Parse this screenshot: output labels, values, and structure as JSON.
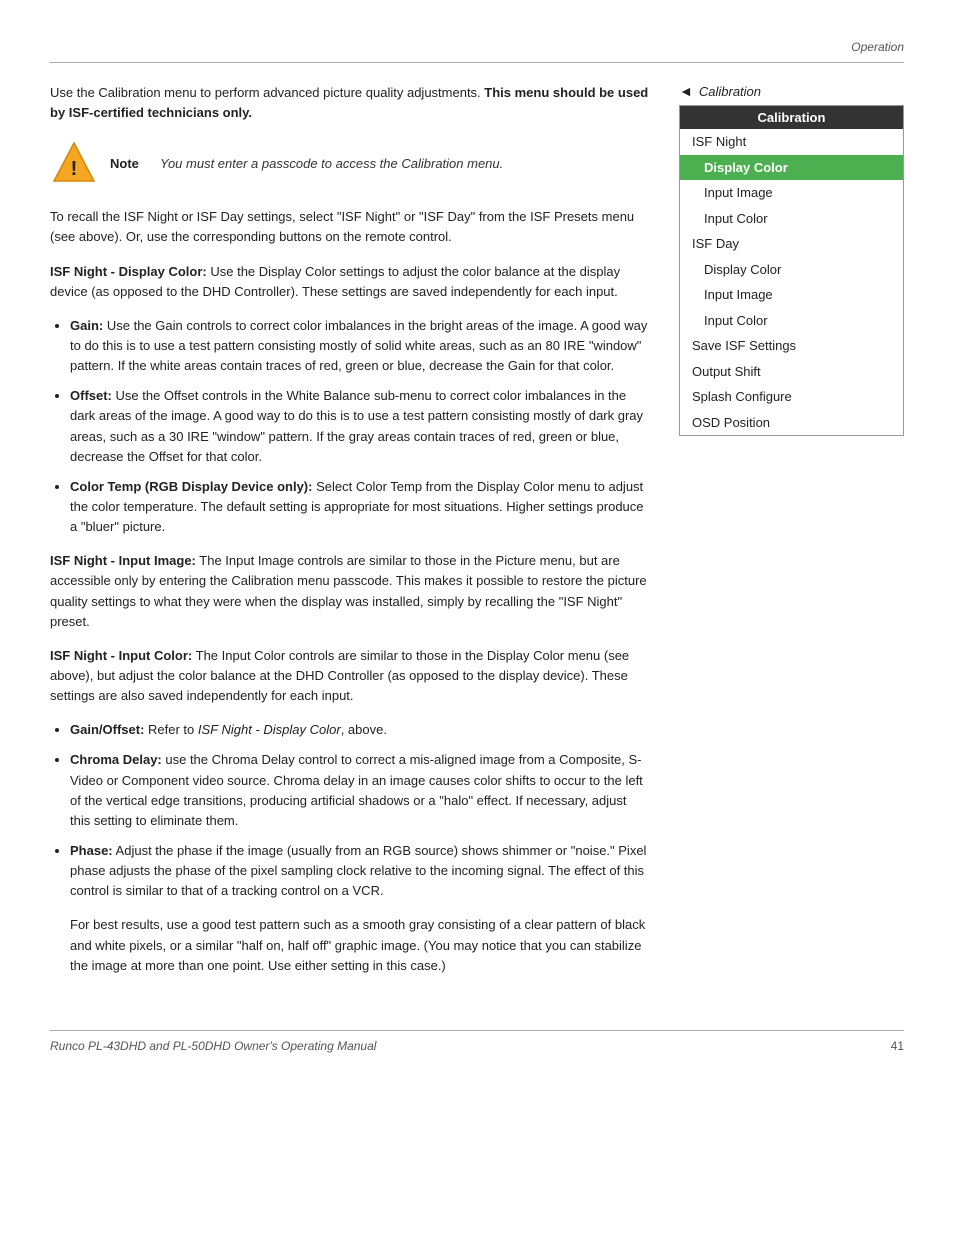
{
  "page": {
    "header": "Operation",
    "footer_title": "Runco PL-43DHD and PL-50DHD Owner's Operating Manual",
    "footer_page": "41"
  },
  "intro": {
    "text1": "Use the Calibration menu to perform advanced picture quality adjustments. ",
    "text1_bold": "This menu should be used by ISF-certified technicians only."
  },
  "note": {
    "label": "Note",
    "text": "You must enter a passcode to access the Calibration menu."
  },
  "recall_para": "To recall the ISF Night or ISF Day settings, select \"ISF Night\" or \"ISF Day\" from the ISF Presets menu (see above). Or, use the corresponding buttons on the remote control.",
  "sections": [
    {
      "id": "isf-night-display-color",
      "heading": "ISF Night - Display Color:",
      "text": " Use the Display Color settings to adjust the color balance at the display device (as opposed to the DHD Controller). These settings are saved independently for each input."
    },
    {
      "id": "isf-night-input-image",
      "heading": "ISF Night - Input Image:",
      "text": " The Input Image controls are similar to those in the Picture menu, but are accessible only by entering the Calibration menu passcode. This makes it possible to restore the picture quality settings to what they were when the display was installed, simply by recalling the \"ISF Night\" preset."
    },
    {
      "id": "isf-night-input-color",
      "heading": "ISF Night - Input Color:",
      "text": " The Input Color controls are similar to those in the Display Color menu (see above), but adjust the color balance at the DHD Controller (as opposed to the display device). These settings are also saved independently for each input."
    }
  ],
  "bullets_display_color": [
    {
      "heading": "Gain:",
      "text": " Use the Gain controls to correct color imbalances in the bright areas of the image. A good way to do this is to use a test pattern consisting mostly of solid white areas, such as an 80 IRE \"window\" pattern. If the white areas contain traces of red, green or blue, decrease the Gain for that color."
    },
    {
      "heading": "Offset:",
      "text": " Use the Offset controls in the White Balance sub-menu to correct color imbalances in the dark areas of the image. A good way to do this is to use a test pattern consisting mostly of dark gray areas, such as a 30 IRE \"window\" pattern. If the gray areas contain traces of red, green or blue, decrease the Offset for that color."
    },
    {
      "heading": "Color Temp (RGB Display Device only):",
      "text": " Select Color Temp from the Display Color menu to adjust the color temperature. The default setting is appropriate for most situations. Higher settings produce a \"bluer\" picture."
    }
  ],
  "bullets_input_color": [
    {
      "heading": "Gain/Offset:",
      "text": " Refer to ",
      "text_italic": "ISF Night - Display Color",
      "text_end": ", above."
    },
    {
      "heading": "Chroma Delay:",
      "text": " use the Chroma Delay control to correct a mis-aligned image from a Composite, S-Video or Component video source. Chroma delay in an image causes color shifts to occur to the left of the vertical edge transitions, producing artificial shadows or a \"halo\" effect. If necessary, adjust this setting to eliminate them."
    },
    {
      "heading": "Phase:",
      "text": " Adjust the phase if the image (usually from an RGB source) shows shimmer or \"noise.\" Pixel phase adjusts the phase of the pixel sampling clock relative to the incoming signal. The effect of this control is similar to that of a tracking control on a VCR."
    }
  ],
  "phase_extra_para": "For best results, use a good test pattern such as a smooth gray consisting of a clear pattern of black and white pixels, or a similar \"half on, half off\" graphic image. (You may notice that you can stabilize the image at more than one point. Use either setting in this case.)",
  "sidebar": {
    "arrow_label": "◄",
    "title": "Calibration",
    "menu_header": "Calibration",
    "items": [
      {
        "label": "ISF Night",
        "level": 1,
        "selected": false
      },
      {
        "label": "Display Color",
        "level": 2,
        "selected": true
      },
      {
        "label": "Input Image",
        "level": 2,
        "selected": false
      },
      {
        "label": "Input Color",
        "level": 2,
        "selected": false
      },
      {
        "label": "ISF Day",
        "level": 1,
        "selected": false
      },
      {
        "label": "Display Color",
        "level": 2,
        "selected": false
      },
      {
        "label": "Input Image",
        "level": 2,
        "selected": false
      },
      {
        "label": "Input Color",
        "level": 2,
        "selected": false
      },
      {
        "label": "Save ISF Settings",
        "level": 1,
        "selected": false
      },
      {
        "label": "Output Shift",
        "level": 1,
        "selected": false
      },
      {
        "label": "Splash Configure",
        "level": 1,
        "selected": false
      },
      {
        "label": "OSD Position",
        "level": 1,
        "selected": false
      }
    ]
  }
}
